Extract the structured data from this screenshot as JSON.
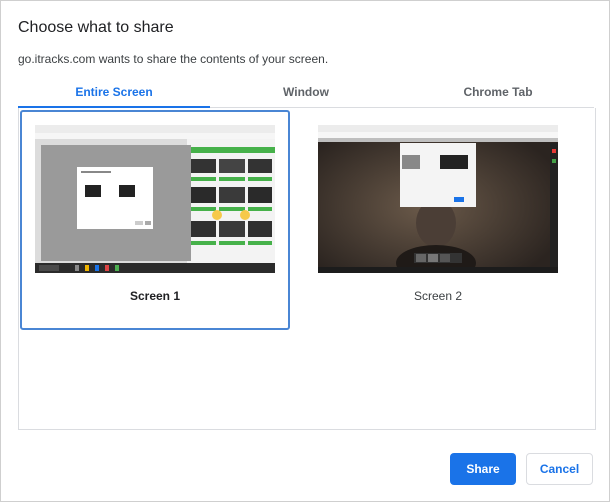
{
  "dialog": {
    "title": "Choose what to share",
    "subtitle": "go.itracks.com wants to share the contents of your screen."
  },
  "tabs": [
    {
      "label": "Entire Screen",
      "active": true
    },
    {
      "label": "Window",
      "active": false
    },
    {
      "label": "Chrome Tab",
      "active": false
    }
  ],
  "screens": [
    {
      "label": "Screen 1",
      "selected": true
    },
    {
      "label": "Screen 2",
      "selected": false
    }
  ],
  "buttons": {
    "share": "Share",
    "cancel": "Cancel"
  },
  "colors": {
    "accent": "#1a73e8",
    "selection_border": "#4a86d4"
  }
}
